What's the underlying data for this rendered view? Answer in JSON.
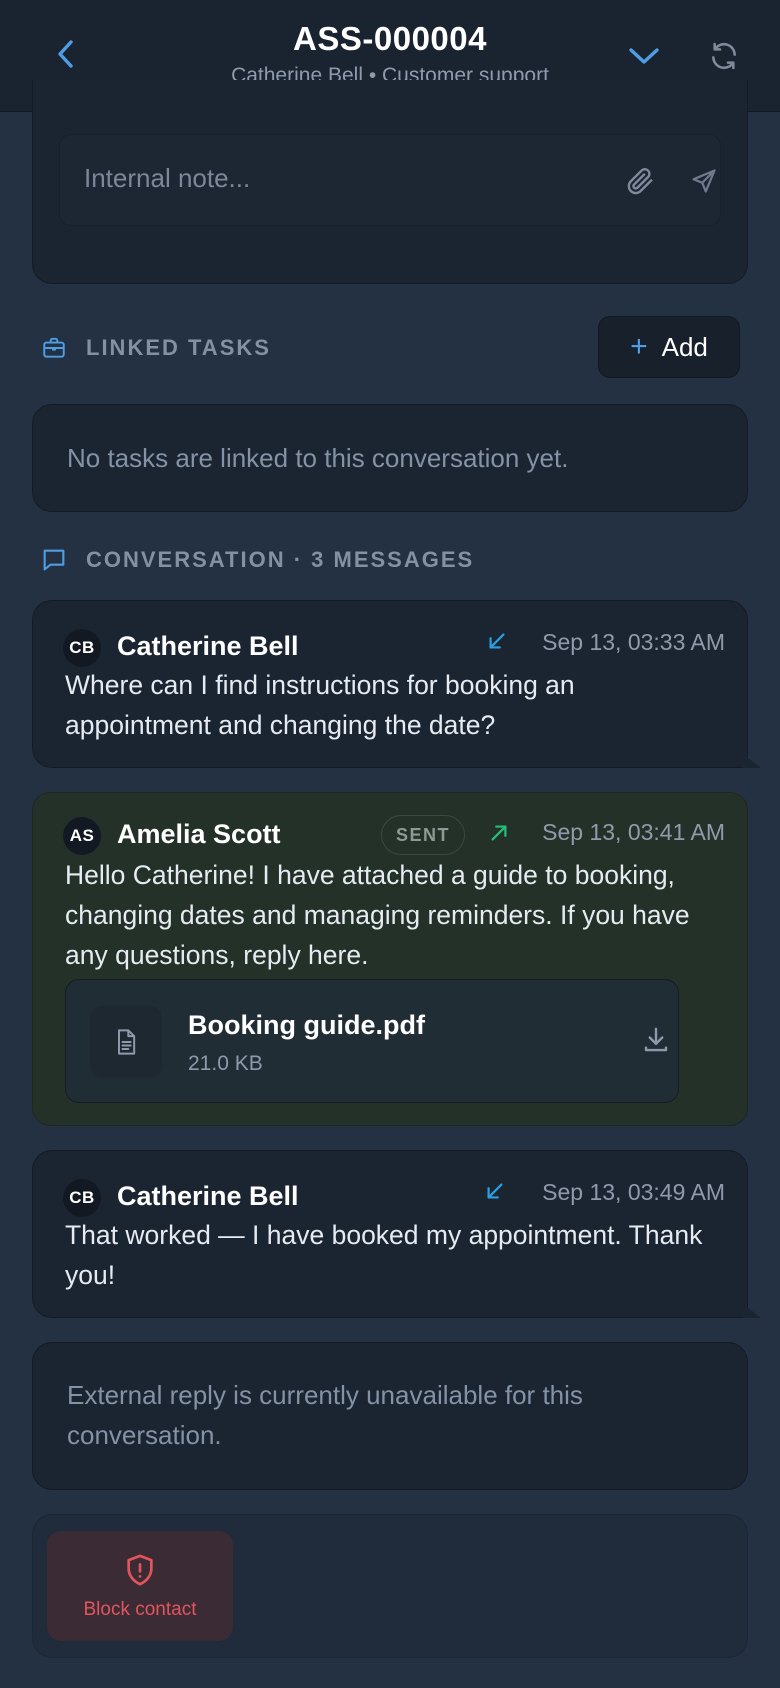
{
  "header": {
    "title": "ASS-000004",
    "subtitle": "Catherine Bell • Customer support",
    "icons": {
      "back": "chevron-left-icon",
      "expand": "chevron-down-icon",
      "refresh": "refresh-icon"
    }
  },
  "note": {
    "placeholder": "Internal note...",
    "icons": {
      "attach": "paperclip-icon",
      "send": "send-icon"
    }
  },
  "linked_tasks": {
    "heading": "LINKED TASKS",
    "add_label": "Add",
    "empty_text": "No tasks are linked to this conversation yet."
  },
  "conversation": {
    "heading": "CONVERSATION · 3 MESSAGES",
    "messages": [
      {
        "initials": "CB",
        "author": "Catherine Bell",
        "direction": "incoming",
        "timestamp": "Sep 13, 03:33 AM",
        "text": "Where can I find instructions for booking an appointment and changing the date?"
      },
      {
        "initials": "AS",
        "author": "Amelia Scott",
        "direction": "outgoing",
        "status": "SENT",
        "timestamp": "Sep 13, 03:41 AM",
        "text": "Hello Catherine! I have attached a guide to booking, changing dates and managing reminders. If you have any questions, reply here.",
        "attachment": {
          "name": "Booking guide.pdf",
          "size": "21.0 KB"
        }
      },
      {
        "initials": "CB",
        "author": "Catherine Bell",
        "direction": "incoming",
        "timestamp": "Sep 13, 03:49 AM",
        "text": "That worked — I have booked my appointment. Thank you!"
      }
    ]
  },
  "external_reply_notice": "External reply is currently unavailable for this conversation.",
  "actions": {
    "block_label": "Block contact"
  },
  "colors": {
    "accent": "#4e9ee6",
    "incoming_arrow": "#2aa0e0",
    "outgoing_arrow": "#23c07a",
    "danger": "#e3545c"
  }
}
